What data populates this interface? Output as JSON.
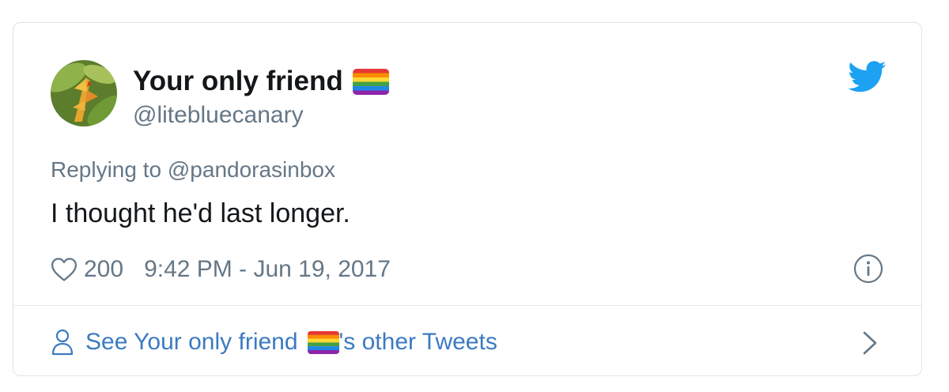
{
  "tweet": {
    "display_name": "Your only friend",
    "handle": "@litebluecanary",
    "replying_prefix": "Replying to",
    "replying_to": "@pandorasinbox",
    "text": "I thought he'd last longer.",
    "likes": "200",
    "timestamp": "9:42 PM - Jun 19, 2017"
  },
  "footer": {
    "prefix": "See Your only friend",
    "suffix": "'s other Tweets"
  },
  "icons": {
    "brand": "twitter-bird-icon",
    "like": "heart-icon",
    "info": "info-icon",
    "profile": "person-icon",
    "more": "chevron-right-icon",
    "flag": "rainbow-flag-icon"
  },
  "colors": {
    "text": "#14171a",
    "secondary": "#657786",
    "twitter_blue": "#1da1f2",
    "link": "#3b7ac1",
    "border": "#dfe3e8"
  }
}
